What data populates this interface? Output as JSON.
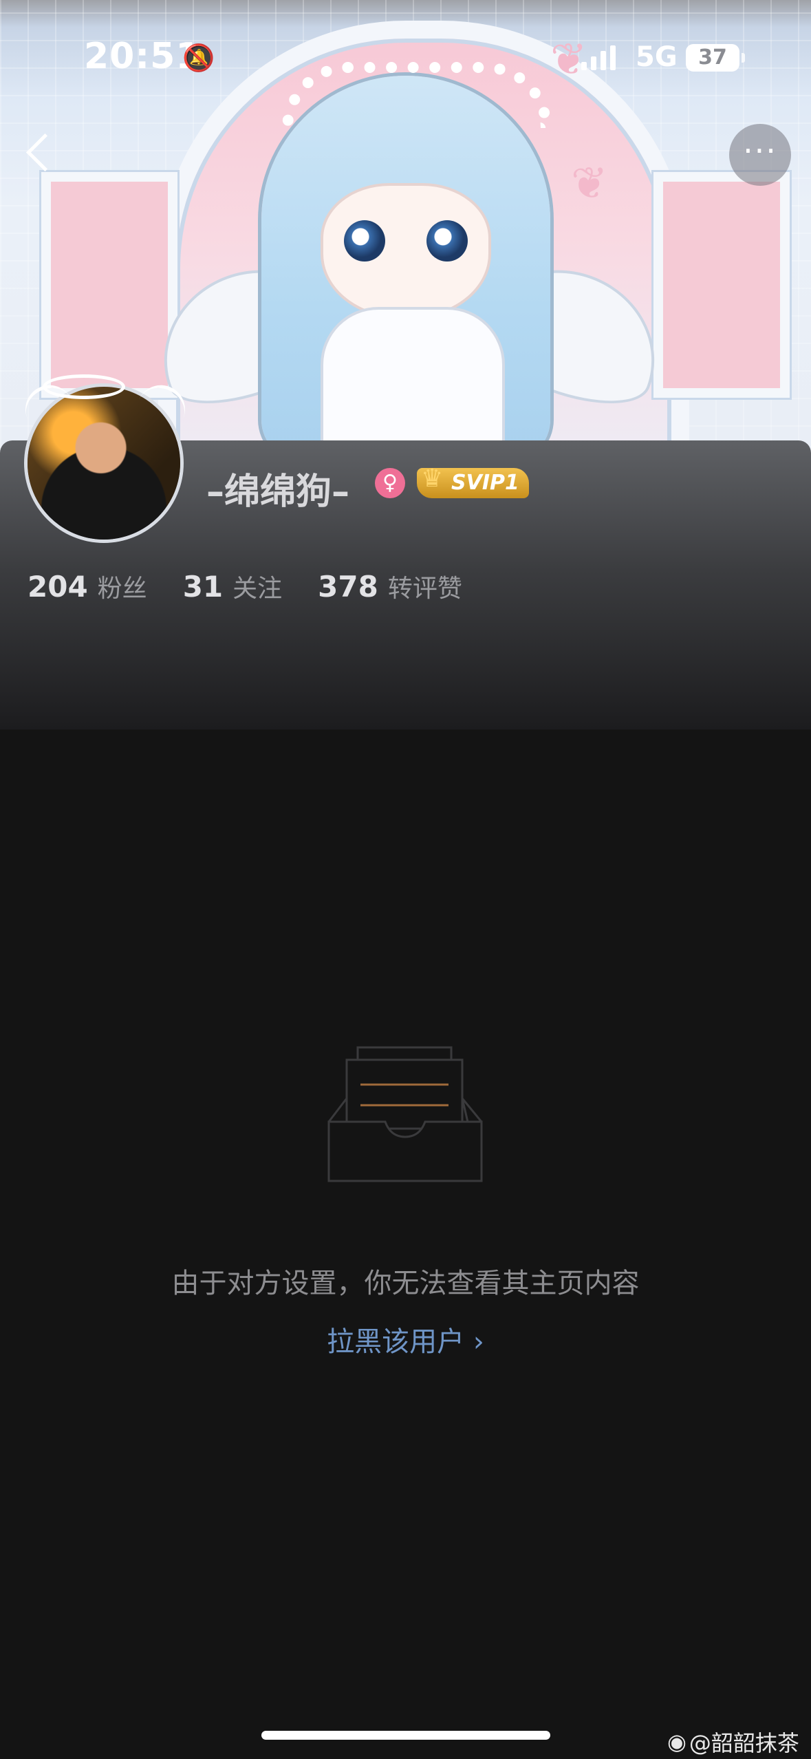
{
  "status_bar": {
    "time": "20:51",
    "network": "5G",
    "battery": "37"
  },
  "profile": {
    "username": "–绵绵狗–",
    "gender_symbol": "♀",
    "vip_badge": "SVIP1",
    "stats": [
      {
        "value": "204",
        "label": "粉丝"
      },
      {
        "value": "31",
        "label": "关注"
      },
      {
        "value": "378",
        "label": "转评赞"
      }
    ]
  },
  "restricted": {
    "message": "由于对方设置，你无法查看其主页内容",
    "block_link": "拉黑该用户 ›"
  },
  "watermark": "@韶韶抹茶",
  "colors": {
    "background": "#141414",
    "link": "#6f95c7",
    "gender": "#ef6f96",
    "vip": "#e0a830"
  }
}
